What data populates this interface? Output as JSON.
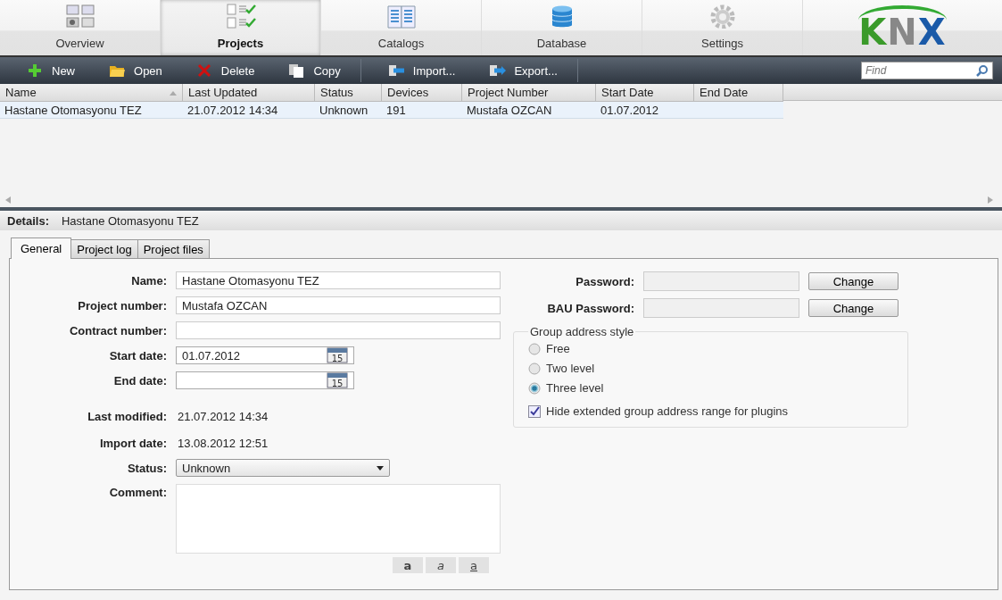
{
  "nav_tabs": [
    {
      "label": "Overview",
      "selected": false
    },
    {
      "label": "Projects",
      "selected": true
    },
    {
      "label": "Catalogs",
      "selected": false
    },
    {
      "label": "Database",
      "selected": false
    },
    {
      "label": "Settings",
      "selected": false
    }
  ],
  "logo": {
    "text": "KNX"
  },
  "toolbar": {
    "buttons": [
      {
        "label": "New"
      },
      {
        "label": "Open"
      },
      {
        "label": "Delete"
      },
      {
        "label": "Copy"
      },
      {
        "label": "Import..."
      },
      {
        "label": "Export..."
      }
    ],
    "search": {
      "placeholder": "Find"
    }
  },
  "table": {
    "columns": [
      {
        "label": "Name",
        "sorted": true
      },
      {
        "label": "Last Updated",
        "sorted": false
      },
      {
        "label": "Status",
        "sorted": false
      },
      {
        "label": "Devices",
        "sorted": false
      },
      {
        "label": "Project Number",
        "sorted": false
      },
      {
        "label": "Start Date",
        "sorted": false
      },
      {
        "label": "End Date",
        "sorted": false
      }
    ],
    "rows": [
      {
        "selected": true,
        "cells": [
          "Hastane Otomasyonu TEZ",
          "21.07.2012 14:34",
          "Unknown",
          "191",
          "Mustafa OZCAN",
          "01.07.2012"
        ]
      }
    ]
  },
  "details": {
    "label": "Details:",
    "value": "Hastane Otomasyonu TEZ"
  },
  "detail_tabs": [
    {
      "label": "General",
      "selected": true
    },
    {
      "label": "Project log",
      "selected": false
    },
    {
      "label": "Project files",
      "selected": false
    }
  ],
  "form": {
    "left": [
      {
        "kind": "text",
        "label": "Name:",
        "value": "Hastane Otomasyonu TEZ"
      },
      {
        "kind": "text",
        "label": "Project number:",
        "value": "Mustafa OZCAN"
      },
      {
        "kind": "text",
        "label": "Contract number:"
      },
      {
        "kind": "date",
        "label": "Start date:",
        "value": "01.07.2012",
        "calendar_day": "15"
      },
      {
        "kind": "date",
        "label": "End date:",
        "calendar_day": "15"
      },
      {
        "kind": "readonly",
        "label": "Last modified:",
        "value": "21.07.2012 14:34"
      },
      {
        "kind": "readonly",
        "label": "Import date:",
        "value": "13.08.2012 12:51"
      },
      {
        "kind": "select",
        "label": "Status:",
        "value": "Unknown"
      },
      {
        "kind": "textarea",
        "label": "Comment:"
      }
    ],
    "format_buttons": [
      {
        "label": "a",
        "kind": "bold"
      },
      {
        "label": "a",
        "kind": "italic"
      },
      {
        "label": "a",
        "kind": "underline"
      }
    ],
    "passwords": [
      {
        "label": "Password:",
        "button": "Change"
      },
      {
        "label": "BAU Password:",
        "button": "Change"
      }
    ],
    "group_address": {
      "legend": "Group address style",
      "options": [
        {
          "label": "Free",
          "selected": false
        },
        {
          "label": "Two level",
          "selected": false
        },
        {
          "label": "Three level",
          "selected": true
        }
      ],
      "checkbox": {
        "label": "Hide extended group address range for plugins",
        "checked": true
      }
    }
  }
}
